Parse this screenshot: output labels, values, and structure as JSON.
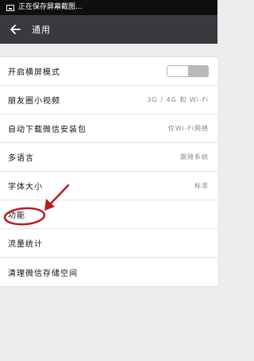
{
  "status_bar": {
    "text": "正在保存屏幕截图..."
  },
  "header": {
    "title": "通用"
  },
  "settings": [
    {
      "label": "开启横屏模式",
      "value": null,
      "toggle": "off"
    },
    {
      "label": "朋友圈小视频",
      "value": "3G / 4G 和 Wi-Fi"
    },
    {
      "label": "自动下载微信安装包",
      "value": "仅Wi-Fi网络"
    },
    {
      "label": "多语言",
      "value": "跟随系统"
    },
    {
      "label": "字体大小",
      "value": "标准"
    },
    {
      "label": "功能",
      "value": null
    },
    {
      "label": "流量统计",
      "value": null
    },
    {
      "label": "清理微信存储空间",
      "value": null
    }
  ],
  "colors": {
    "header_bg": "#393a3f",
    "status_bg": "#0f0f0f",
    "annotation": "#b81d24"
  }
}
